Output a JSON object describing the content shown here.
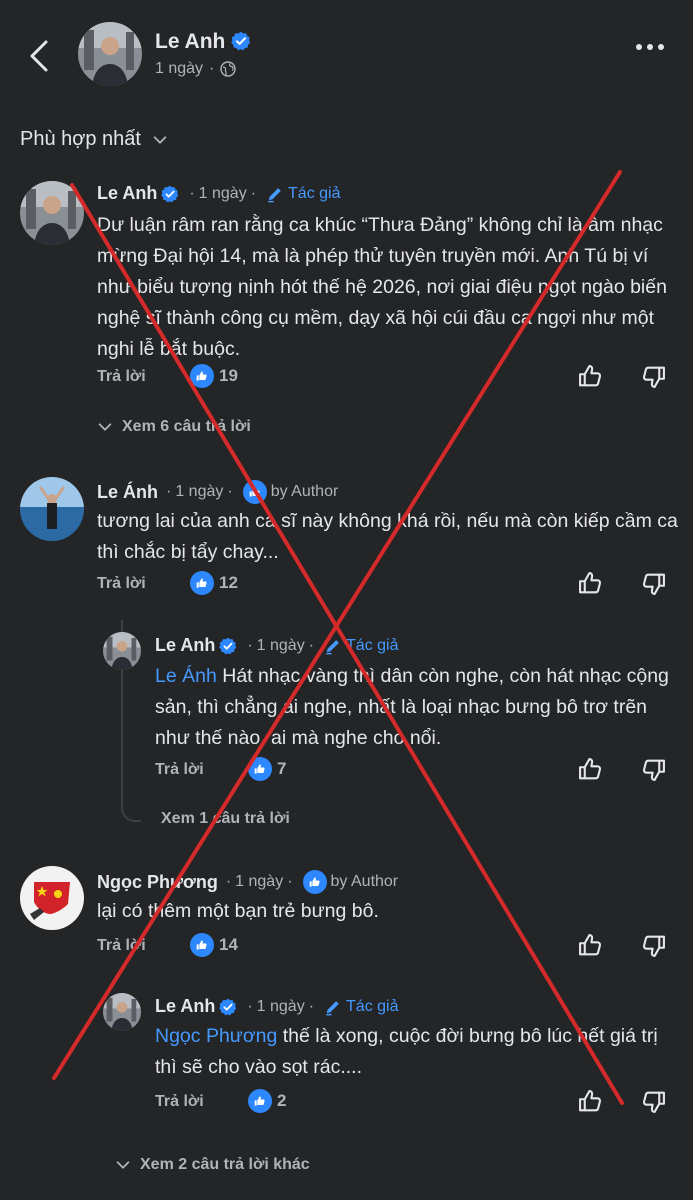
{
  "header": {
    "name": "Le Anh",
    "time": "1 ngày",
    "privacy_icon": "globe-icon"
  },
  "sort": {
    "label": "Phù hợp nhất"
  },
  "comments": [
    {
      "name": "Le Anh",
      "verified": true,
      "time": "1 ngày",
      "badge": "Tác giả",
      "badge_icon": "pencil-icon",
      "text": "Dư luận râm ran rằng ca khúc “Thưa Đảng” không chỉ là âm nhạc mừng Đại hội 14, mà là phép thử tuyên truyền mới. Anh Tú bị ví như biểu tượng nịnh hót thế hệ 2026, nơi giai điệu ngọt ngào biến nghệ sĩ thành công cụ mềm, dạy xã hội cúi đầu ca ngợi như một nghi lễ bắt buộc.",
      "reply_label": "Trả lời",
      "likes": "19",
      "view_replies": "Xem 6 câu trả lời"
    },
    {
      "name": "Le Ánh",
      "verified": false,
      "time": "1 ngày",
      "badge": "by Author",
      "text": "tương lai của anh ca sĩ này không khá rồi, nếu mà còn kiếp cầm ca thì chắc bị tẩy chay...",
      "reply_label": "Trả lời",
      "likes": "12",
      "reply": {
        "name": "Le Anh",
        "time": "1 ngày",
        "badge": "Tác giả",
        "mention": "Le Ánh",
        "text": " Hát nhạc vàng thì dân còn nghe, còn hát nhạc cộng sản, thì chẳng ai nghe, nhất là loại nhạc bưng bô trơ trẽn như thế nào, ai mà nghe cho nổi.",
        "reply_label": "Trả lời",
        "likes": "7",
        "view_replies": "Xem 1 câu trả lời"
      }
    },
    {
      "name": "Ngọc Phương",
      "verified": false,
      "time": "1 ngày",
      "badge": "by Author",
      "text": "lại có thêm một bạn trẻ bưng bô.",
      "reply_label": "Trả lời",
      "likes": "14",
      "reply": {
        "name": "Le Anh",
        "time": "1 ngày",
        "badge": "Tác giả",
        "mention": "Ngọc Phương",
        "text": " thế là xong, cuộc đời bưng bô lúc hết giá trị thì sẽ cho vào sọt rác....",
        "reply_label": "Trả lời",
        "likes": "2"
      },
      "view_more": "Xem 2 câu trả lời khác"
    }
  ],
  "colors": {
    "background": "#242526",
    "accent": "#2d88ff",
    "link": "#4599ff",
    "overlay_x": "#d42a2a"
  }
}
